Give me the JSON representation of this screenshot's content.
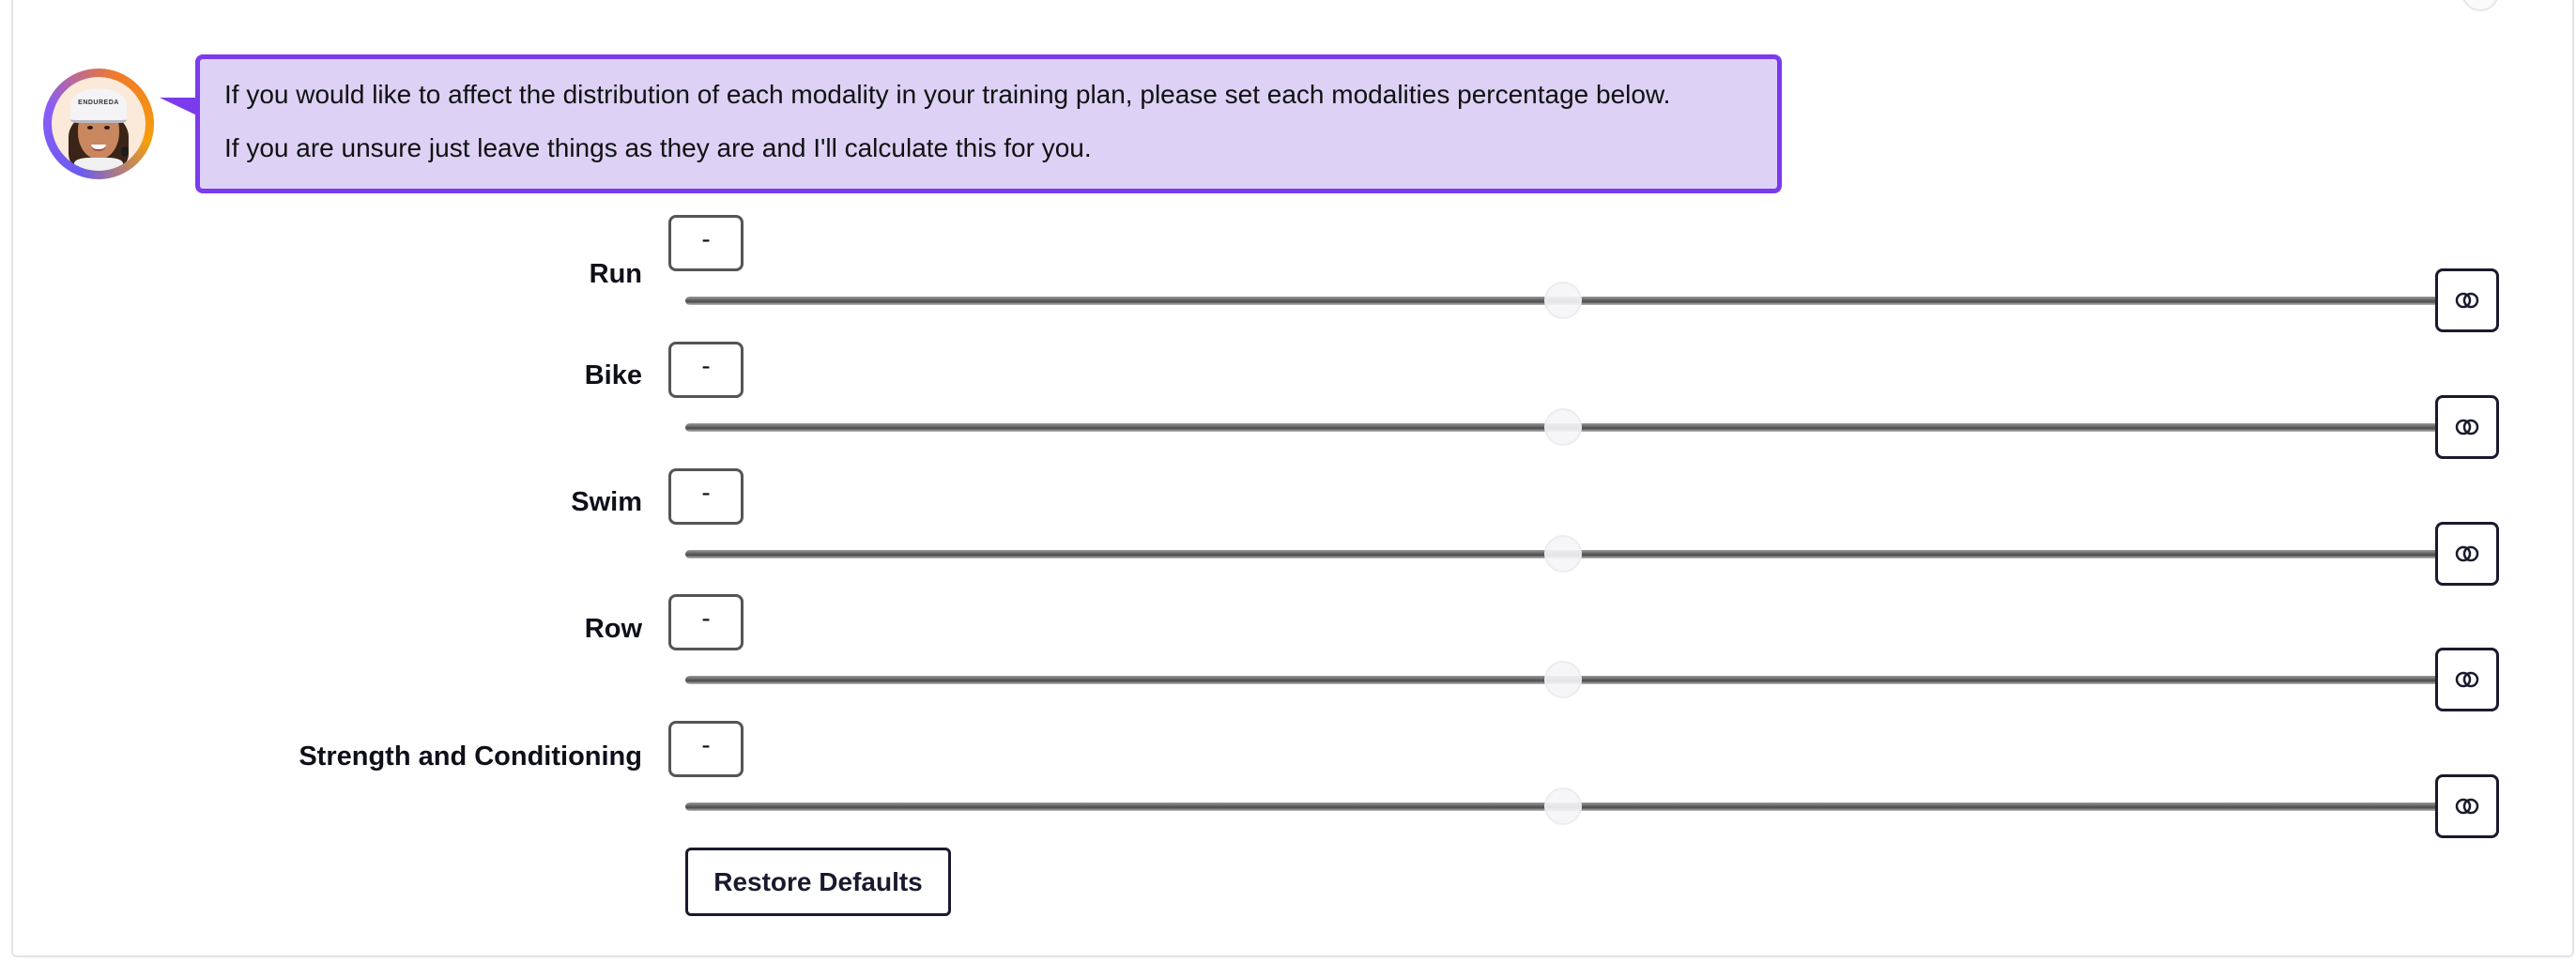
{
  "bubble": {
    "line1": "If you would like to affect the distribution of each modality in your training plan, please set each modalities percentage below.",
    "line2": "If you are unsure just leave things as they are and I'll calculate this for you."
  },
  "avatar": {
    "cap_text": "ENDUREDA"
  },
  "modalities": [
    {
      "label": "Run",
      "value": "-",
      "slider_fraction": 0.5,
      "lock_icon": "link-toggle-icon"
    },
    {
      "label": "Bike",
      "value": "-",
      "slider_fraction": 0.5,
      "lock_icon": "link-toggle-icon"
    },
    {
      "label": "Swim",
      "value": "-",
      "slider_fraction": 0.5,
      "lock_icon": "link-toggle-icon"
    },
    {
      "label": "Row",
      "value": "-",
      "slider_fraction": 0.5,
      "lock_icon": "link-toggle-icon"
    },
    {
      "label": "Strength and Conditioning",
      "value": "-",
      "slider_fraction": 0.5,
      "lock_icon": "link-toggle-icon"
    }
  ],
  "actions": {
    "restore_label": "Restore Defaults"
  },
  "colors": {
    "accent": "#7c3aed",
    "bubble_bg": "#ddd2f5",
    "border_dark": "#1a1a2e"
  }
}
